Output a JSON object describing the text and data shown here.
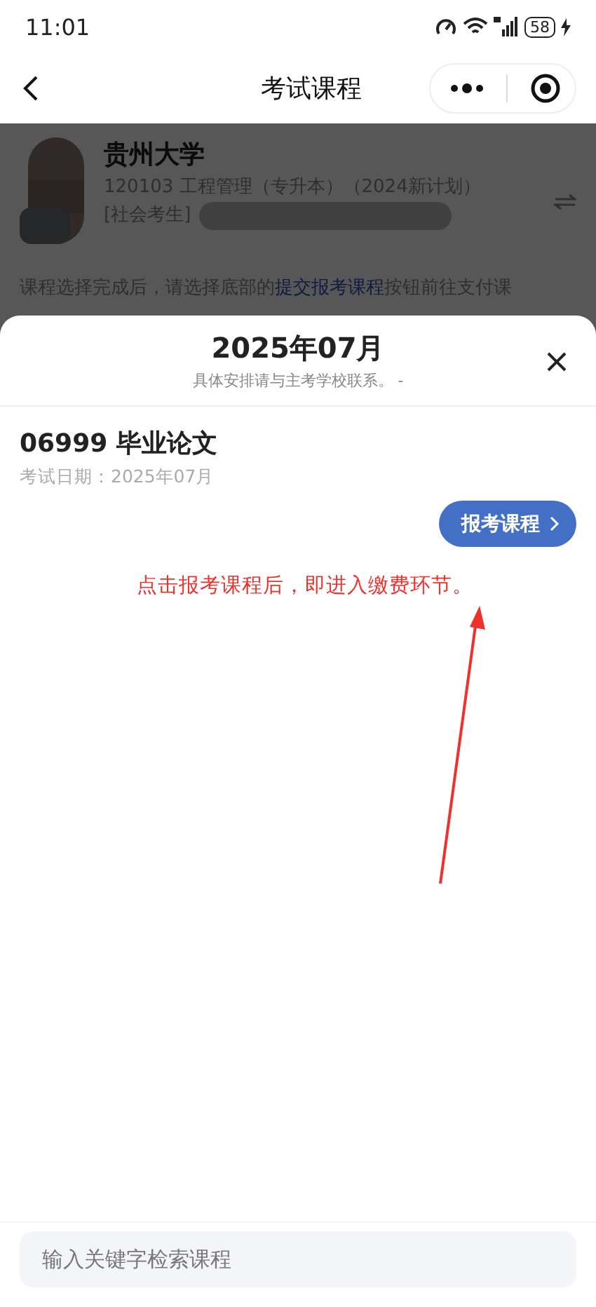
{
  "status_bar": {
    "time": "11:01",
    "battery": "58"
  },
  "nav": {
    "title": "考试课程"
  },
  "profile": {
    "school": "贵州大学",
    "major": "120103 工程管理（专升本）（2024新计划）",
    "category": "[社会考生]"
  },
  "notice": {
    "before": "课程选择完成后，请选择底部的",
    "link": "提交报考课程",
    "after": "按钮前往支付课"
  },
  "sheet": {
    "title": "2025年07月",
    "subtitle": "具体安排请与主考学校联系。 -",
    "courses": [
      {
        "name": "06999 毕业论文",
        "date": "考试日期：2025年07月",
        "button": "报考课程"
      }
    ],
    "annotation": "点击报考课程后，即进入缴费环节。",
    "search": {
      "placeholder": "输入关键字检索课程"
    }
  }
}
